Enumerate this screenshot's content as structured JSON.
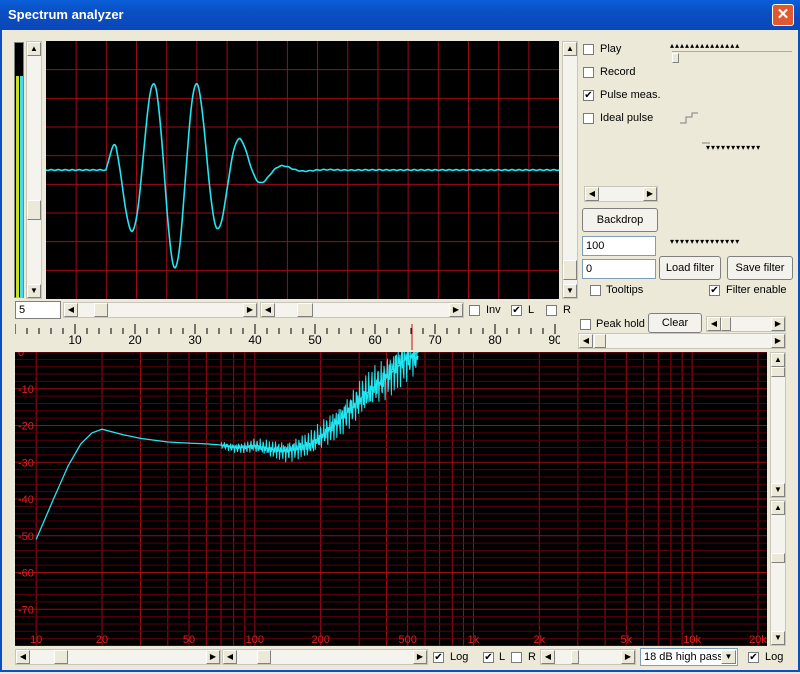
{
  "window": {
    "title": "Spectrum analyzer",
    "close_glyph": "✕"
  },
  "panel": {
    "checkboxes": [
      {
        "label": "Play",
        "checked": false
      },
      {
        "label": "Record",
        "checked": false
      },
      {
        "label": "Pulse meas.",
        "checked": true
      },
      {
        "label": "Ideal pulse",
        "checked": false
      }
    ],
    "backdrop_label": "Backdrop",
    "input_100": "100",
    "input_0": "0",
    "load_filter_label": "Load filter",
    "save_filter_label": "Save filter",
    "tooltips_label": "Tooltips",
    "tooltips_checked": false,
    "filter_enable_label": "Filter enable",
    "filter_enable_checked": true,
    "peak_hold_label": "Peak hold",
    "peak_hold_checked": false,
    "clear_label": "Clear"
  },
  "time_controls": {
    "zoom_value": "5",
    "inv_label": "Inv",
    "inv_checked": false,
    "l_label": "L",
    "l_checked": true,
    "r_label": "R",
    "r_checked": false,
    "ruler_ticks": [
      "10",
      "20",
      "30",
      "40",
      "50",
      "60",
      "70",
      "80",
      "90"
    ]
  },
  "spectrum_controls": {
    "log_label": "Log",
    "log_checked": true,
    "l_label": "L",
    "l_checked": true,
    "r_label": "R",
    "r_checked": false,
    "filter_select": "18 dB high pass",
    "log2_label": "Log",
    "log2_checked": true
  },
  "colors": {
    "trace": "#22e6f0",
    "grid": "#9e0a16",
    "grid_minor": "#5a0009",
    "plot_bg": "#000000"
  },
  "waveform_chart": {
    "type": "line",
    "description_axis": "time",
    "grid_divisions_x": 17,
    "grid_divisions_y": 9
  },
  "chart_data": {
    "type": "line",
    "title": "",
    "xlabel": "",
    "ylabel": "",
    "x_scale": "log",
    "xlim": [
      8,
      22000
    ],
    "ylim": [
      -80,
      0
    ],
    "x_tick_labels": [
      "10",
      "20",
      "50",
      "100",
      "200",
      "500",
      "1k",
      "2k",
      "5k",
      "10k",
      "20k"
    ],
    "y_tick_labels": [
      "0",
      "-10",
      "-20",
      "-30",
      "-40",
      "-50",
      "-60",
      "-70"
    ],
    "grid": true,
    "series": [
      {
        "x": [
          10,
          12,
          14,
          16,
          18,
          20,
          25,
          30,
          40,
          50,
          60,
          70,
          80,
          90,
          100,
          120,
          140,
          160,
          180,
          200,
          220,
          250,
          280,
          300,
          350,
          400,
          450,
          500,
          560
        ],
        "y": [
          -51,
          -40,
          -31,
          -25,
          -22,
          -21,
          -22.5,
          -23.5,
          -24.5,
          -24.8,
          -25,
          -25.3,
          -26,
          -26,
          -25.5,
          -26.5,
          -27,
          -26,
          -25,
          -23,
          -21,
          -18,
          -15,
          -13,
          -9.5,
          -7,
          -4,
          -1.5,
          0
        ]
      }
    ]
  }
}
